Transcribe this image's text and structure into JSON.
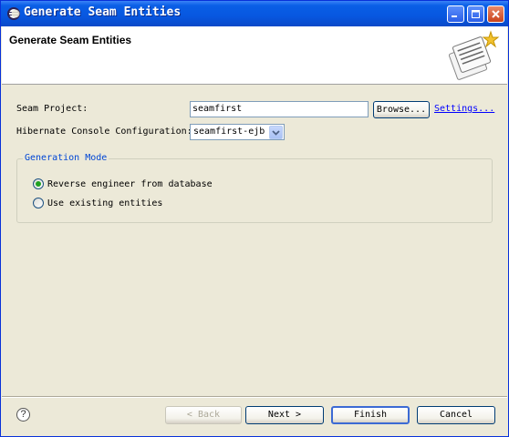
{
  "window": {
    "title": "Generate Seam Entities"
  },
  "banner": {
    "title": "Generate Seam Entities"
  },
  "form": {
    "seam_project_label": "Seam Project:",
    "seam_project_value": "seamfirst",
    "browse_label": "Browse...",
    "settings_label": "Settings...",
    "console_config_label": "Hibernate Console Configuration:",
    "console_config_value": "seamfirst-ejb"
  },
  "generation_mode": {
    "title": "Generation Mode",
    "options": [
      {
        "label": "Reverse engineer from database",
        "selected": true
      },
      {
        "label": "Use existing entities",
        "selected": false
      }
    ]
  },
  "footer": {
    "help_symbol": "?",
    "back_label": "Back",
    "next_label": "Next",
    "finish_label": "Finish",
    "cancel_label": "Cancel"
  },
  "colors": {
    "title_bar": "#0757e0",
    "dialog_bg": "#ece9d8",
    "group_title": "#0046d5",
    "link": "#0000ff"
  }
}
